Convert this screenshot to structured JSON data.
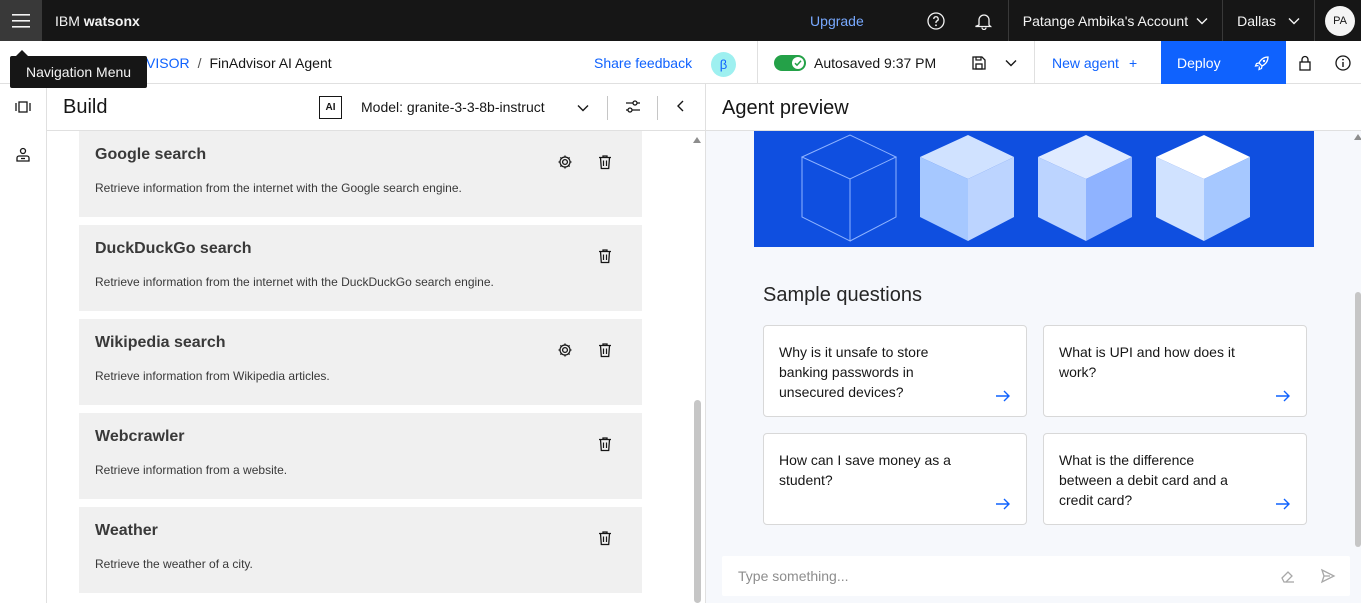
{
  "topbar": {
    "brand_prefix": "IBM",
    "brand_name": "watsonx",
    "upgrade": "Upgrade",
    "account": "Patange Ambika's Account",
    "region": "Dallas",
    "avatar": "PA"
  },
  "tooltip": "Navigation Menu",
  "breadcrumb": {
    "parent": "VISOR",
    "separator": "/",
    "current": "FinAdvisor AI Agent"
  },
  "header_actions": {
    "share_feedback": "Share feedback",
    "beta": "β",
    "autosaved": "Autosaved 9:37 PM",
    "autosave_enabled": true,
    "new_agent": "New agent",
    "new_agent_plus": "+",
    "deploy": "Deploy"
  },
  "build": {
    "title": "Build",
    "ai_badge": "AI",
    "model": "Model: granite-3-3-8b-instruct",
    "tools": [
      {
        "name": "Google search",
        "description": "Retrieve information from the internet with the Google search engine.",
        "has_settings": true
      },
      {
        "name": "DuckDuckGo search",
        "description": "Retrieve information from the internet with the DuckDuckGo search engine.",
        "has_settings": false
      },
      {
        "name": "Wikipedia search",
        "description": "Retrieve information from Wikipedia articles.",
        "has_settings": true
      },
      {
        "name": "Webcrawler",
        "description": "Retrieve information from a website.",
        "has_settings": false
      },
      {
        "name": "Weather",
        "description": "Retrieve the weather of a city.",
        "has_settings": false
      }
    ]
  },
  "preview": {
    "title": "Agent preview",
    "sample_title": "Sample questions",
    "questions": [
      "Why is it unsafe to store banking passwords in unsecured devices?",
      "What is UPI and how does it work?",
      "How can I save money as a student?",
      "What is the difference between a debit card and a credit card?"
    ],
    "input_placeholder": "Type something..."
  },
  "colors": {
    "accent": "#0f62fe",
    "topbar": "#161616",
    "toggle_on": "#24a148",
    "hero": "#0f4fe0"
  }
}
